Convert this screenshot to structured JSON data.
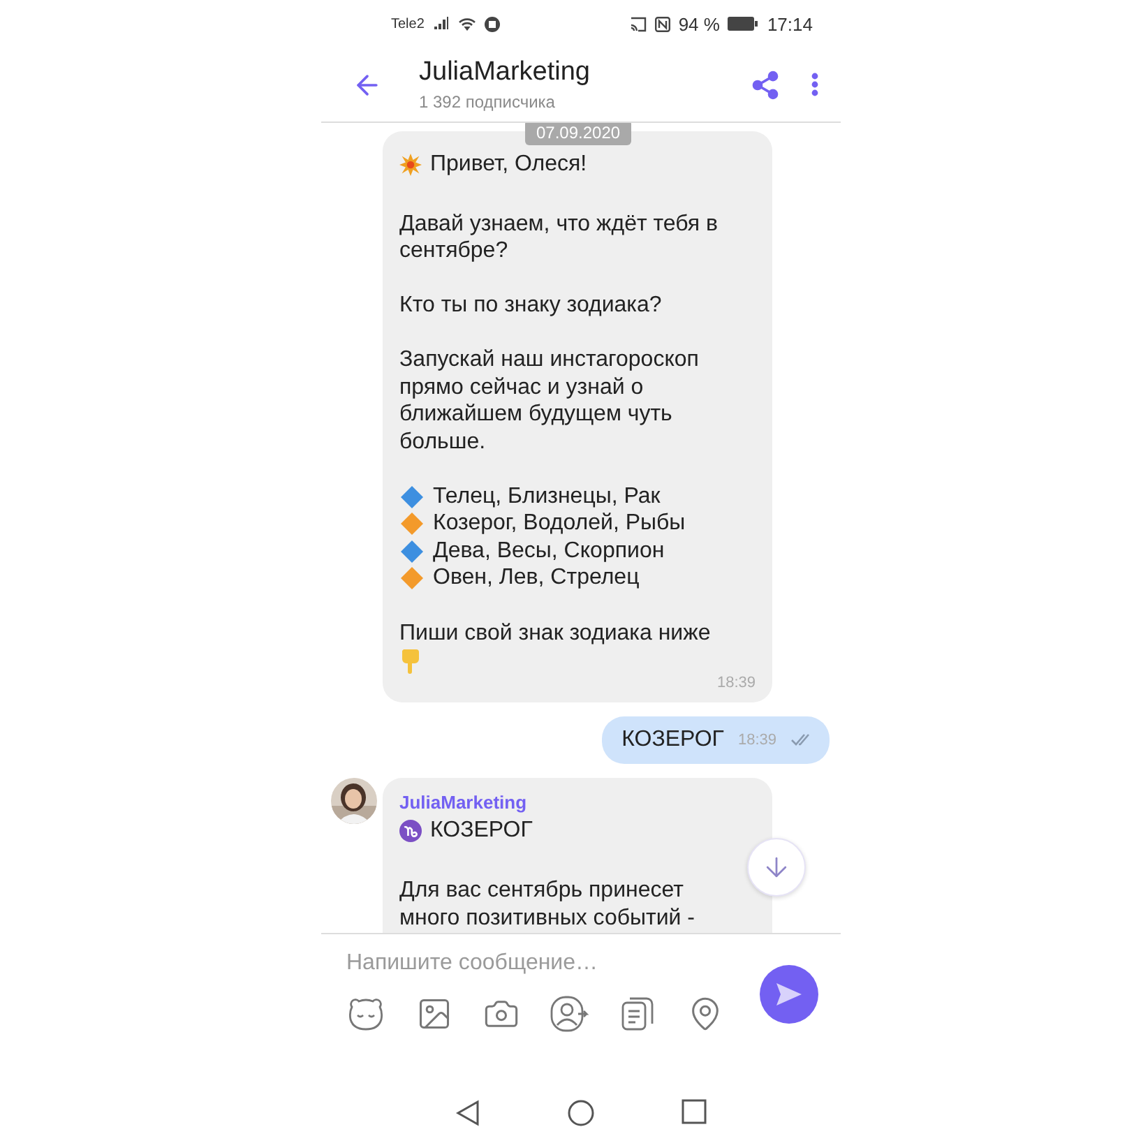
{
  "status_bar": {
    "carrier": "Tele2",
    "battery": "94 %",
    "time": "17:14"
  },
  "header": {
    "title": "JuliaMarketing",
    "subtitle": "1 392 подписчика"
  },
  "messages": [
    {
      "kind": "incoming",
      "date": "07.09.2020",
      "time": "18:39",
      "blocks": [
        {
          "kind": "greeting",
          "text": "Привет, Олеся!"
        },
        {
          "kind": "text",
          "text": "Давай узнаем, что ждёт тебя в сентябре?"
        },
        {
          "kind": "text",
          "text": "Кто ты по знаку зодиака?"
        },
        {
          "kind": "text",
          "text": "Запускай наш инстагороскоп прямо сейчас и узнай о ближайшем будущем чуть больше."
        },
        {
          "kind": "list",
          "items": [
            {
              "text": "Телец, Близнецы, Рак",
              "color": "#3d8fe0"
            },
            {
              "text": "Козерог, Водолей, Рыбы",
              "color": "#f39a2b"
            },
            {
              "text": "Дева, Весы, Скорпион",
              "color": "#3d8fe0"
            },
            {
              "text": "Овен, Лев, Стрелец",
              "color": "#f39a2b"
            }
          ]
        },
        {
          "kind": "closing",
          "text": "Пиши свой знак зодиака ниже"
        }
      ]
    },
    {
      "kind": "outgoing",
      "text": "КОЗЕРОГ",
      "time": "18:39",
      "read": true
    },
    {
      "kind": "channel_post",
      "sender": "JuliaMarketing",
      "title": "КОЗЕРОГ",
      "text": "Для вас сентябрь принесет много позитивных событий -"
    }
  ],
  "composer": {
    "placeholder": "Напишите сообщение…"
  }
}
